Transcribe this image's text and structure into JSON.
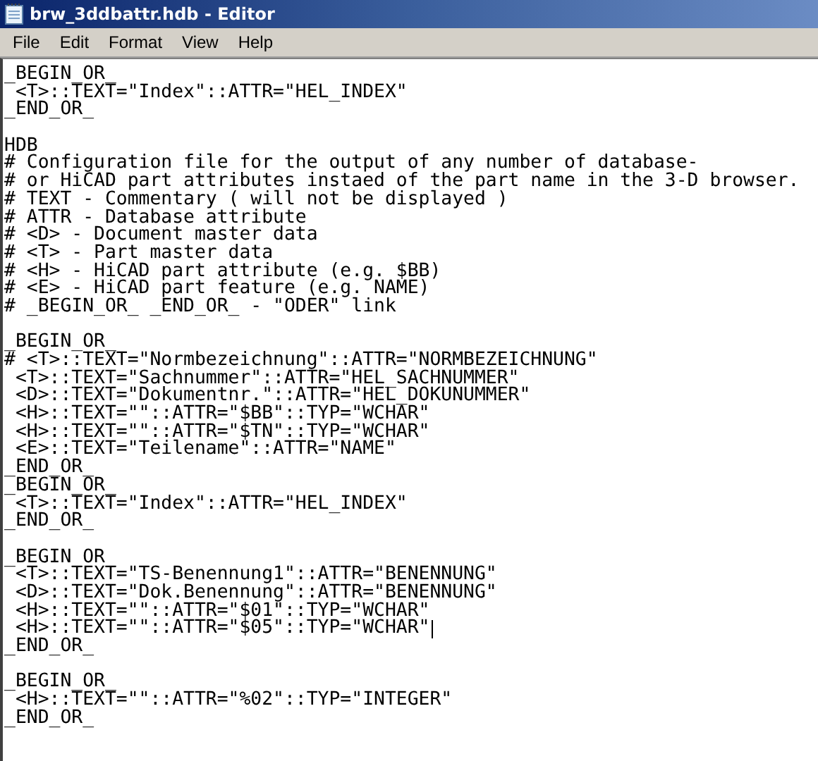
{
  "window": {
    "title": "brw_3ddbattr.hdb - Editor"
  },
  "menu": [
    "File",
    "Edit",
    "Format",
    "View",
    "Help"
  ],
  "lines": [
    {
      "kind": "text",
      "text": "_BEGIN_OR_",
      "caret": false
    },
    {
      "kind": "text",
      "text": " <T>::TEXT=\"Index\"::ATTR=\"HEL_INDEX\"",
      "caret": false
    },
    {
      "kind": "text",
      "text": "_END_OR_",
      "caret": false
    },
    {
      "kind": "blank"
    },
    {
      "kind": "text",
      "text": "HDB",
      "caret": false
    },
    {
      "kind": "text",
      "text": "# Configuration file for the output of any number of database-",
      "caret": false
    },
    {
      "kind": "text",
      "text": "# or HiCAD part attributes instaed of the part name in the 3-D browser.",
      "caret": false
    },
    {
      "kind": "text",
      "text": "# TEXT - Commentary ( will not be displayed )",
      "caret": false
    },
    {
      "kind": "text",
      "text": "# ATTR - Database attribute",
      "caret": false
    },
    {
      "kind": "text",
      "text": "# <D> - Document master data",
      "caret": false
    },
    {
      "kind": "text",
      "text": "# <T> - Part master data",
      "caret": false
    },
    {
      "kind": "text",
      "text": "# <H> - HiCAD part attribute (e.g. $BB)",
      "caret": false
    },
    {
      "kind": "text",
      "text": "# <E> - HiCAD part feature (e.g. NAME)",
      "caret": false
    },
    {
      "kind": "text",
      "text": "# _BEGIN_OR_ _END_OR_ - \"ODER\" link",
      "caret": false
    },
    {
      "kind": "blank"
    },
    {
      "kind": "text",
      "text": "_BEGIN_OR_",
      "caret": false
    },
    {
      "kind": "text",
      "text": "# <T>::TEXT=\"Normbezeichnung\"::ATTR=\"NORMBEZEICHNUNG\"",
      "caret": false
    },
    {
      "kind": "text",
      "text": " <T>::TEXT=\"Sachnummer\"::ATTR=\"HEL_SACHNUMMER\"",
      "caret": false
    },
    {
      "kind": "text",
      "text": " <D>::TEXT=\"Dokumentnr.\"::ATTR=\"HEL_DOKUNUMMER\"",
      "caret": false
    },
    {
      "kind": "text",
      "text": " <H>::TEXT=\"\"::ATTR=\"$BB\"::TYP=\"WCHAR\"",
      "caret": false
    },
    {
      "kind": "text",
      "text": " <H>::TEXT=\"\"::ATTR=\"$TN\"::TYP=\"WCHAR\"",
      "caret": false
    },
    {
      "kind": "text",
      "text": " <E>::TEXT=\"Teilename\"::ATTR=\"NAME\"",
      "caret": false
    },
    {
      "kind": "text",
      "text": "_END_OR_",
      "caret": false
    },
    {
      "kind": "text",
      "text": "_BEGIN_OR_",
      "caret": false
    },
    {
      "kind": "text",
      "text": " <T>::TEXT=\"Index\"::ATTR=\"HEL_INDEX\"",
      "caret": false
    },
    {
      "kind": "text",
      "text": "_END_OR_",
      "caret": false
    },
    {
      "kind": "blank"
    },
    {
      "kind": "text",
      "text": "_BEGIN_OR_",
      "caret": false
    },
    {
      "kind": "text",
      "text": " <T>::TEXT=\"TS-Benennung1\"::ATTR=\"BENENNUNG\"",
      "caret": false
    },
    {
      "kind": "text",
      "text": " <D>::TEXT=\"Dok.Benennung\"::ATTR=\"BENENNUNG\"",
      "caret": false
    },
    {
      "kind": "text",
      "text": " <H>::TEXT=\"\"::ATTR=\"$01\"::TYP=\"WCHAR\"",
      "caret": false
    },
    {
      "kind": "text",
      "text": " <H>::TEXT=\"\"::ATTR=\"$05\"::TYP=\"WCHAR\"",
      "caret": true
    },
    {
      "kind": "text",
      "text": "_END_OR_",
      "caret": false
    },
    {
      "kind": "blank"
    },
    {
      "kind": "text",
      "text": "_BEGIN_OR_",
      "caret": false
    },
    {
      "kind": "text",
      "text": " <H>::TEXT=\"\"::ATTR=\"%02\"::TYP=\"INTEGER\"",
      "caret": false
    },
    {
      "kind": "text",
      "text": "_END_OR_",
      "caret": false
    }
  ]
}
